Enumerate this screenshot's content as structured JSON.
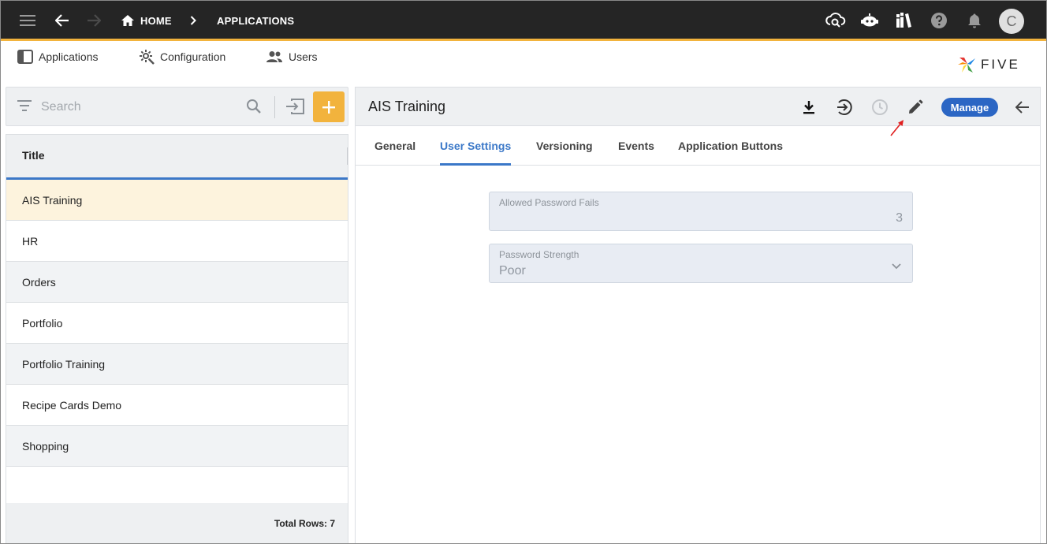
{
  "topbar": {
    "breadcrumb": [
      {
        "label": "HOME"
      },
      {
        "label": "APPLICATIONS"
      }
    ],
    "avatar_initial": "C"
  },
  "modules": [
    {
      "label": "Applications",
      "icon": "panel-icon"
    },
    {
      "label": "Configuration",
      "icon": "gear-wrench-icon"
    },
    {
      "label": "Users",
      "icon": "users-icon"
    }
  ],
  "logo": {
    "text": "FIVE"
  },
  "search": {
    "placeholder": "Search"
  },
  "list": {
    "header": "Title",
    "rows": [
      {
        "title": "AIS Training"
      },
      {
        "title": "HR"
      },
      {
        "title": "Orders"
      },
      {
        "title": "Portfolio"
      },
      {
        "title": "Portfolio Training"
      },
      {
        "title": "Recipe Cards Demo"
      },
      {
        "title": "Shopping"
      }
    ],
    "footer": "Total Rows: 7"
  },
  "form": {
    "title": "AIS Training",
    "manage_label": "Manage",
    "tabs": [
      {
        "label": "General"
      },
      {
        "label": "User Settings"
      },
      {
        "label": "Versioning"
      },
      {
        "label": "Events"
      },
      {
        "label": "Application Buttons"
      }
    ],
    "active_tab": "User Settings",
    "fields": {
      "allowed_password_fails": {
        "label": "Allowed Password Fails",
        "value": "3"
      },
      "password_strength": {
        "label": "Password Strength",
        "value": "Poor"
      }
    }
  },
  "colors": {
    "topbar": "#252525",
    "accent_yellow": "#f2b33d",
    "accent_blue": "#3b78c8",
    "manage_button": "#2b66c4",
    "selected_row": "#fdf3dd",
    "annotation_arrow": "#e02020"
  }
}
